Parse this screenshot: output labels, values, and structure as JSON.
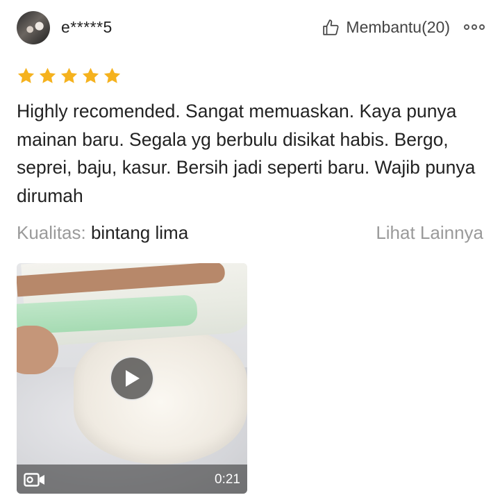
{
  "review": {
    "username": "e*****5",
    "helpful_label": "Membantu(20)",
    "rating": 5,
    "star_color": "#F5B21E",
    "text": "Highly recomended. Sangat memuaskan. Kaya punya mainan baru. Segala yg berbulu disikat habis. Bergo, seprei, baju, kasur. Bersih jadi seperti baru. Wajib punya dirumah",
    "quality_label": "Kualitas:",
    "quality_value": "bintang lima",
    "see_more_label": "Lihat Lainnya"
  },
  "video": {
    "duration": "0:21"
  },
  "icons": {
    "helpful": "thumbs-up-icon",
    "more": "more-options-icon",
    "play": "play-icon",
    "video_type": "video-camera-icon"
  }
}
